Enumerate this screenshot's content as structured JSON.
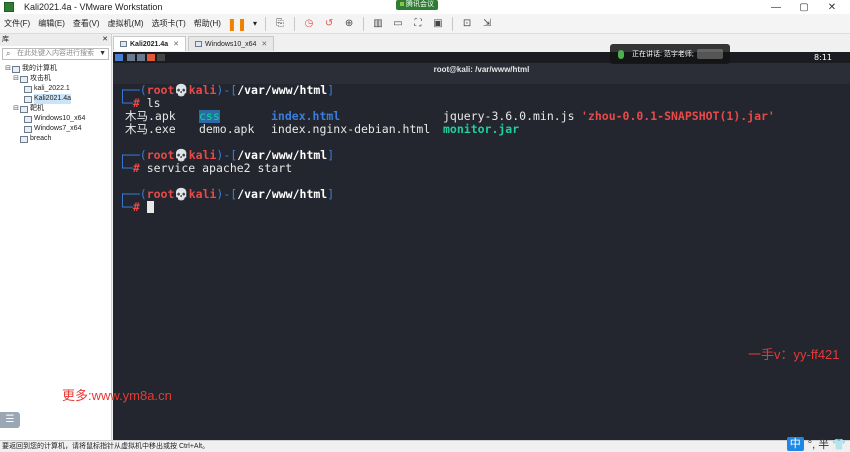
{
  "window": {
    "title": "Kali2021.4a - VMware Workstation",
    "controls": [
      "—",
      "▢",
      "✕"
    ],
    "meeting_badge": "腾讯会议"
  },
  "menu": {
    "items": [
      "文件(F)",
      "编辑(E)",
      "查看(V)",
      "虚拟机(M)",
      "选项卡(T)",
      "帮助(H)"
    ]
  },
  "library": {
    "header": "库",
    "search_placeholder": "在此处键入内容进行搜索",
    "tree": [
      {
        "label": "我的计算机",
        "level": 0,
        "expander": "⊟"
      },
      {
        "label": "攻击机",
        "level": 1,
        "expander": "⊟"
      },
      {
        "label": "kali_2022.1",
        "level": 2,
        "expander": ""
      },
      {
        "label": "Kali2021.4a",
        "level": 2,
        "expander": "",
        "selected": true
      },
      {
        "label": "靶机",
        "level": 1,
        "expander": "⊟"
      },
      {
        "label": "Windows10_x64",
        "level": 2,
        "expander": ""
      },
      {
        "label": "Windows7_x64",
        "level": 2,
        "expander": ""
      },
      {
        "label": "breach",
        "level": 1,
        "expander": ""
      }
    ]
  },
  "tabs": [
    {
      "label": "Kali2021.4a",
      "active": true
    },
    {
      "label": "Windows10_x64",
      "active": false
    }
  ],
  "vm": {
    "clock": "8:11",
    "terminal_title": "root@kali: /var/www/html"
  },
  "terminal": {
    "prompt": {
      "top_left": "┌──(",
      "user": "root💀kali",
      "mid": ")-[",
      "path": "/var/www/html",
      "end": "]",
      "bottom": "└─",
      "hash": "#"
    },
    "cmd1": "ls",
    "ls_row1": {
      "c1": "木马.apk",
      "c2": "css",
      "c3": "index.html",
      "c4": "jquery-3.6.0.min.js",
      "c5": "'zhou-0.0.1-SNAPSHOT(1).jar'"
    },
    "ls_row2": {
      "c1": "木马.exe",
      "c2": "demo.apk",
      "c3": "index.nginx-debian.html",
      "c4": "monitor.jar"
    },
    "cmd2": "service apache2 start"
  },
  "meeting_overlay": {
    "text": "正在讲话: 范宇老师;"
  },
  "watermarks": {
    "right": "一手v：yy-ff421",
    "left": "更多:www.ym8a.cn"
  },
  "statusbar": {
    "text": "要返回到您的计算机，请将鼠标指针从虚拟机中移出或按 Ctrl+Alt。"
  },
  "ime": {
    "lang": "中",
    "rest": "°, 半 👕"
  }
}
